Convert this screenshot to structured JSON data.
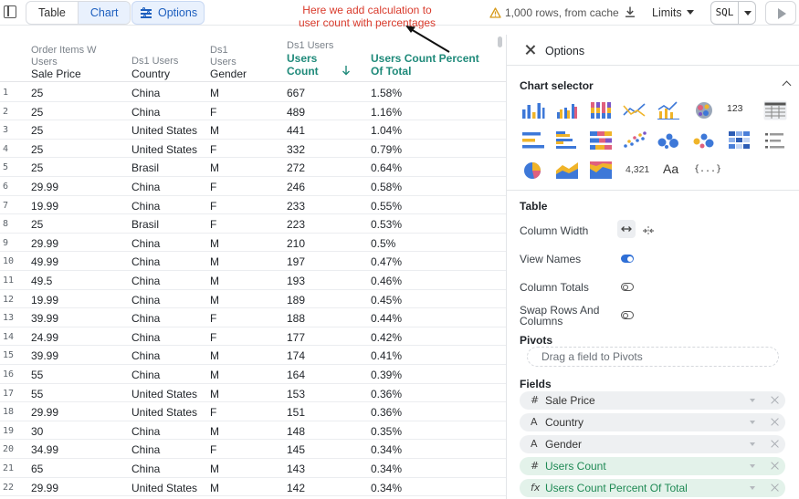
{
  "toolbar": {
    "tabs": [
      "Table",
      "Chart"
    ],
    "options_label": "Options",
    "annotation": "Here we add calculation to user count with percentages",
    "cache_status": "1,000 rows, from cache",
    "limits_label": "Limits",
    "sql_label": "SQL"
  },
  "table": {
    "columns": [
      {
        "sub": "Order Items W Users",
        "main": "Sale Price"
      },
      {
        "sub": "Ds1 Users",
        "main": "Country"
      },
      {
        "sub": "Ds1",
        "main": "Gender"
      },
      {
        "sub": "Ds1 Users",
        "main": "Users Count"
      },
      {
        "sub": "",
        "main": "Users Count Percent Of Total"
      }
    ],
    "col1_sub_l1": "Order Items W",
    "col1_sub_l2": "Users",
    "col2_sub": "Ds1 Users",
    "col3_sub_l1": "Ds1",
    "col3_sub_l2": "Users",
    "col4_sub": "Ds1 Users",
    "col4_main_l1": "Users",
    "col4_main_l2": "Count",
    "col5_main_l1": "Users Count Percent",
    "col5_main_l2": "Of Total",
    "rows": [
      [
        "1",
        "25",
        "China",
        "M",
        "667",
        "1.58%"
      ],
      [
        "2",
        "25",
        "China",
        "F",
        "489",
        "1.16%"
      ],
      [
        "3",
        "25",
        "United States",
        "M",
        "441",
        "1.04%"
      ],
      [
        "4",
        "25",
        "United States",
        "F",
        "332",
        "0.79%"
      ],
      [
        "5",
        "25",
        "Brasil",
        "M",
        "272",
        "0.64%"
      ],
      [
        "6",
        "29.99",
        "China",
        "F",
        "246",
        "0.58%"
      ],
      [
        "7",
        "19.99",
        "China",
        "F",
        "233",
        "0.55%"
      ],
      [
        "8",
        "25",
        "Brasil",
        "F",
        "223",
        "0.53%"
      ],
      [
        "9",
        "29.99",
        "China",
        "M",
        "210",
        "0.5%"
      ],
      [
        "10",
        "49.99",
        "China",
        "M",
        "197",
        "0.47%"
      ],
      [
        "11",
        "49.5",
        "China",
        "M",
        "193",
        "0.46%"
      ],
      [
        "12",
        "19.99",
        "China",
        "M",
        "189",
        "0.45%"
      ],
      [
        "13",
        "39.99",
        "China",
        "F",
        "188",
        "0.44%"
      ],
      [
        "14",
        "24.99",
        "China",
        "F",
        "177",
        "0.42%"
      ],
      [
        "15",
        "39.99",
        "China",
        "M",
        "174",
        "0.41%"
      ],
      [
        "16",
        "55",
        "China",
        "M",
        "164",
        "0.39%"
      ],
      [
        "17",
        "55",
        "United States",
        "M",
        "153",
        "0.36%"
      ],
      [
        "18",
        "29.99",
        "United States",
        "F",
        "151",
        "0.36%"
      ],
      [
        "19",
        "30",
        "China",
        "M",
        "148",
        "0.35%"
      ],
      [
        "20",
        "34.99",
        "China",
        "F",
        "145",
        "0.34%"
      ],
      [
        "21",
        "65",
        "China",
        "M",
        "143",
        "0.34%"
      ],
      [
        "22",
        "29.99",
        "United States",
        "M",
        "142",
        "0.34%"
      ]
    ]
  },
  "panel": {
    "title": "Options",
    "chart_selector_title": "Chart selector",
    "number_icon_label": "123",
    "single_value_label": "4,321",
    "text_icon_label": "Aa",
    "json_icon_label": "{...}",
    "table_section": "Table",
    "column_width": "Column Width",
    "view_names": "View Names",
    "column_totals": "Column Totals",
    "swap_l1": "Swap Rows And",
    "swap_l2": "Columns",
    "pivots_title": "Pivots",
    "pivots_placeholder": "Drag a field to Pivots",
    "fields_title": "Fields",
    "fields": [
      {
        "icon": "#",
        "name": "Sale Price"
      },
      {
        "icon": "A",
        "name": "Country"
      },
      {
        "icon": "A",
        "name": "Gender"
      },
      {
        "icon": "#",
        "name": "Users Count"
      },
      {
        "icon": "fx",
        "name": "Users Count Percent Of Total"
      }
    ]
  },
  "colors": {
    "accent": "#1d5fbf",
    "calc_header": "#1f8a7a",
    "annotation": "#d93a2b",
    "calc_field": "#1f8a55"
  }
}
